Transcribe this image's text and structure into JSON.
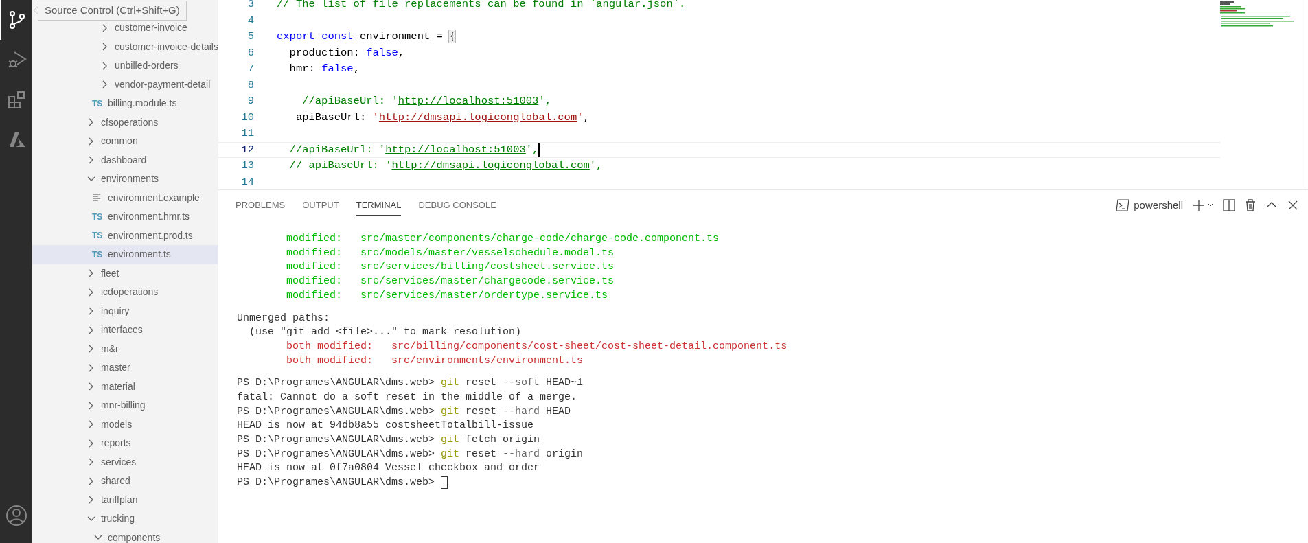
{
  "activity_bar": {
    "items": [
      {
        "kind": "source-control",
        "selected": true
      },
      {
        "kind": "run-debug",
        "selected": false
      },
      {
        "kind": "extensions",
        "selected": false
      },
      {
        "kind": "azure",
        "selected": false
      }
    ]
  },
  "tooltip": {
    "text": "Source Control (Ctrl+Shift+G)"
  },
  "explorer": {
    "items": [
      {
        "children": [
          {
            "children": [
              {
                "kind": "folder",
                "label": "customer-invoice",
                "expanded": false
              },
              {
                "kind": "folder",
                "label": "customer-invoice-details",
                "expanded": false
              },
              {
                "kind": "folder",
                "label": "unbilled-orders",
                "expanded": false
              },
              {
                "kind": "folder",
                "label": "vendor-payment-detail",
                "expanded": false
              }
            ]
          },
          {
            "kind": "file",
            "icon_label": "TS",
            "label": "billing.module.ts",
            "selected": false
          }
        ]
      },
      {
        "kind": "folder",
        "label": "cfsoperations",
        "expanded": false
      },
      {
        "kind": "folder",
        "label": "common",
        "expanded": false
      },
      {
        "kind": "folder",
        "label": "dashboard",
        "expanded": false
      },
      {
        "kind": "folder",
        "label": "environments",
        "expanded": true,
        "children": [
          {
            "kind": "text-file",
            "label": "environment.example",
            "selected": false
          },
          {
            "kind": "file",
            "icon_label": "TS",
            "label": "environment.hmr.ts",
            "selected": false
          },
          {
            "kind": "file",
            "icon_label": "TS",
            "label": "environment.prod.ts",
            "selected": false
          },
          {
            "kind": "file",
            "icon_label": "TS",
            "label": "environment.ts",
            "selected": true
          }
        ]
      },
      {
        "kind": "folder",
        "label": "fleet",
        "expanded": false
      },
      {
        "kind": "folder",
        "label": "icdoperations",
        "expanded": false
      },
      {
        "kind": "folder",
        "label": "inquiry",
        "expanded": false
      },
      {
        "kind": "folder",
        "label": "interfaces",
        "expanded": false
      },
      {
        "kind": "folder",
        "label": "m&r",
        "expanded": false
      },
      {
        "kind": "folder",
        "label": "master",
        "expanded": false
      },
      {
        "kind": "folder",
        "label": "material",
        "expanded": false
      },
      {
        "kind": "folder",
        "label": "mnr-billing",
        "expanded": false
      },
      {
        "kind": "folder",
        "label": "models",
        "expanded": false
      },
      {
        "kind": "folder",
        "label": "reports",
        "expanded": false
      },
      {
        "kind": "folder",
        "label": "services",
        "expanded": false
      },
      {
        "kind": "folder",
        "label": "shared",
        "expanded": false
      },
      {
        "kind": "folder",
        "label": "tariffplan",
        "expanded": false
      },
      {
        "kind": "folder",
        "label": "trucking",
        "expanded": true,
        "children": [
          {
            "kind": "folder",
            "label": "components",
            "expanded": true
          }
        ]
      }
    ]
  },
  "editor": {
    "lines": [
      {
        "number": "3",
        "current": false,
        "tokens": [
          {
            "kind": "comment",
            "text": "// The list of file replacements can be found in `angular.json`."
          }
        ]
      },
      {
        "number": "4",
        "current": false
      },
      {
        "number": "5",
        "current": false,
        "tokens": [
          {
            "kind": "keyword",
            "text": "export "
          },
          {
            "kind": "keyword",
            "text": "const"
          },
          {
            "kind": "plain",
            "text": " environment = "
          },
          {
            "kind": "bracket-match",
            "text": "{"
          }
        ]
      },
      {
        "number": "6",
        "current": false,
        "tokens": [
          {
            "kind": "plain",
            "text": "  production: "
          },
          {
            "kind": "keyword",
            "text": "false"
          },
          {
            "kind": "plain",
            "text": ","
          }
        ]
      },
      {
        "number": "7",
        "current": false,
        "tokens": [
          {
            "kind": "plain",
            "text": "  hmr: "
          },
          {
            "kind": "keyword",
            "text": "false"
          },
          {
            "kind": "plain",
            "text": ","
          }
        ]
      },
      {
        "number": "8",
        "current": false
      },
      {
        "number": "9",
        "current": false,
        "tokens": [
          {
            "kind": "comment",
            "text": "    //apiBaseUrl: '"
          },
          {
            "kind": "comment-link",
            "text": "http://localhost:51003"
          },
          {
            "kind": "comment",
            "text": "',"
          }
        ]
      },
      {
        "number": "10",
        "current": false,
        "tokens": [
          {
            "kind": "plain",
            "text": "   apiBaseUrl: "
          },
          {
            "kind": "string",
            "text": "'"
          },
          {
            "kind": "string-link",
            "text": "http://dmsapi.logiconglobal.com"
          },
          {
            "kind": "string",
            "text": "'"
          },
          {
            "kind": "plain",
            "text": ","
          }
        ]
      },
      {
        "number": "11",
        "current": false
      },
      {
        "number": "12",
        "current": true,
        "cursor": true,
        "tokens": [
          {
            "kind": "comment",
            "text": "  //apiBaseUrl: '"
          },
          {
            "kind": "comment-link",
            "text": "http://localhost:51003"
          },
          {
            "kind": "comment",
            "text": "',"
          }
        ]
      },
      {
        "number": "13",
        "current": false,
        "tokens": [
          {
            "kind": "comment",
            "text": "  // apiBaseUrl: '"
          },
          {
            "kind": "comment-link",
            "text": "http://dmsapi.logiconglobal.com"
          },
          {
            "kind": "comment",
            "text": "',"
          }
        ]
      },
      {
        "number": "14",
        "current": false
      }
    ]
  },
  "panel": {
    "tabs": [
      {
        "label": "PROBLEMS",
        "selected": false
      },
      {
        "label": "OUTPUT",
        "selected": false
      },
      {
        "label": "TERMINAL",
        "selected": true
      },
      {
        "label": "DEBUG CONSOLE",
        "selected": false
      }
    ],
    "terminal_name": "powershell",
    "blocks": [
      [
        {
          "tokens": [
            {
              "kind": "green",
              "text": "        modified:   src/master/components/charge-code/charge-code.component.ts"
            }
          ]
        },
        {
          "tokens": [
            {
              "kind": "green",
              "text": "        modified:   src/models/master/vesselschedule.model.ts"
            }
          ]
        },
        {
          "tokens": [
            {
              "kind": "green",
              "text": "        modified:   src/services/billing/costsheet.service.ts"
            }
          ]
        },
        {
          "tokens": [
            {
              "kind": "green",
              "text": "        modified:   src/services/master/chargecode.service.ts"
            }
          ]
        },
        {
          "tokens": [
            {
              "kind": "green",
              "text": "        modified:   src/services/master/ordertype.service.ts"
            }
          ]
        }
      ],
      [
        {
          "tokens": [
            {
              "kind": "plain",
              "text": "Unmerged paths:"
            }
          ]
        },
        {
          "tokens": [
            {
              "kind": "plain",
              "text": "  (use \"git add <file>...\" to mark resolution)"
            }
          ]
        },
        {
          "tokens": [
            {
              "kind": "red",
              "text": "        both modified:   src/billing/components/cost-sheet/cost-sheet-detail.component.ts"
            }
          ]
        },
        {
          "tokens": [
            {
              "kind": "red",
              "text": "        both modified:   src/environments/environment.ts"
            }
          ]
        }
      ],
      [
        {
          "tokens": [
            {
              "kind": "plain",
              "text": "PS D:\\Programes\\ANGULAR\\dms.web> "
            },
            {
              "kind": "command",
              "text": "git"
            },
            {
              "kind": "plain",
              "text": " reset "
            },
            {
              "kind": "param",
              "text": "--soft"
            },
            {
              "kind": "plain",
              "text": " HEAD~1"
            }
          ]
        },
        {
          "tokens": [
            {
              "kind": "plain",
              "text": "fatal: Cannot do a soft reset in the middle of a merge."
            }
          ]
        },
        {
          "tokens": [
            {
              "kind": "plain",
              "text": "PS D:\\Programes\\ANGULAR\\dms.web> "
            },
            {
              "kind": "command",
              "text": "git"
            },
            {
              "kind": "plain",
              "text": " reset "
            },
            {
              "kind": "param",
              "text": "--hard"
            },
            {
              "kind": "plain",
              "text": " HEAD"
            }
          ]
        },
        {
          "tokens": [
            {
              "kind": "plain",
              "text": "HEAD is now at 94db8a55 costsheetTotalbill-issue"
            }
          ]
        },
        {
          "tokens": [
            {
              "kind": "plain",
              "text": "PS D:\\Programes\\ANGULAR\\dms.web> "
            },
            {
              "kind": "command",
              "text": "git"
            },
            {
              "kind": "plain",
              "text": " fetch origin"
            }
          ]
        },
        {
          "tokens": [
            {
              "kind": "plain",
              "text": "PS D:\\Programes\\ANGULAR\\dms.web> "
            },
            {
              "kind": "command",
              "text": "git"
            },
            {
              "kind": "plain",
              "text": " reset "
            },
            {
              "kind": "param",
              "text": "--hard"
            },
            {
              "kind": "plain",
              "text": " origin"
            }
          ]
        },
        {
          "tokens": [
            {
              "kind": "plain",
              "text": "HEAD is now at 0f7a0804 Vessel checkbox and order"
            }
          ]
        },
        {
          "cursor": true,
          "tokens": [
            {
              "kind": "plain",
              "text": "PS D:\\Programes\\ANGULAR\\dms.web> "
            }
          ]
        }
      ]
    ]
  }
}
